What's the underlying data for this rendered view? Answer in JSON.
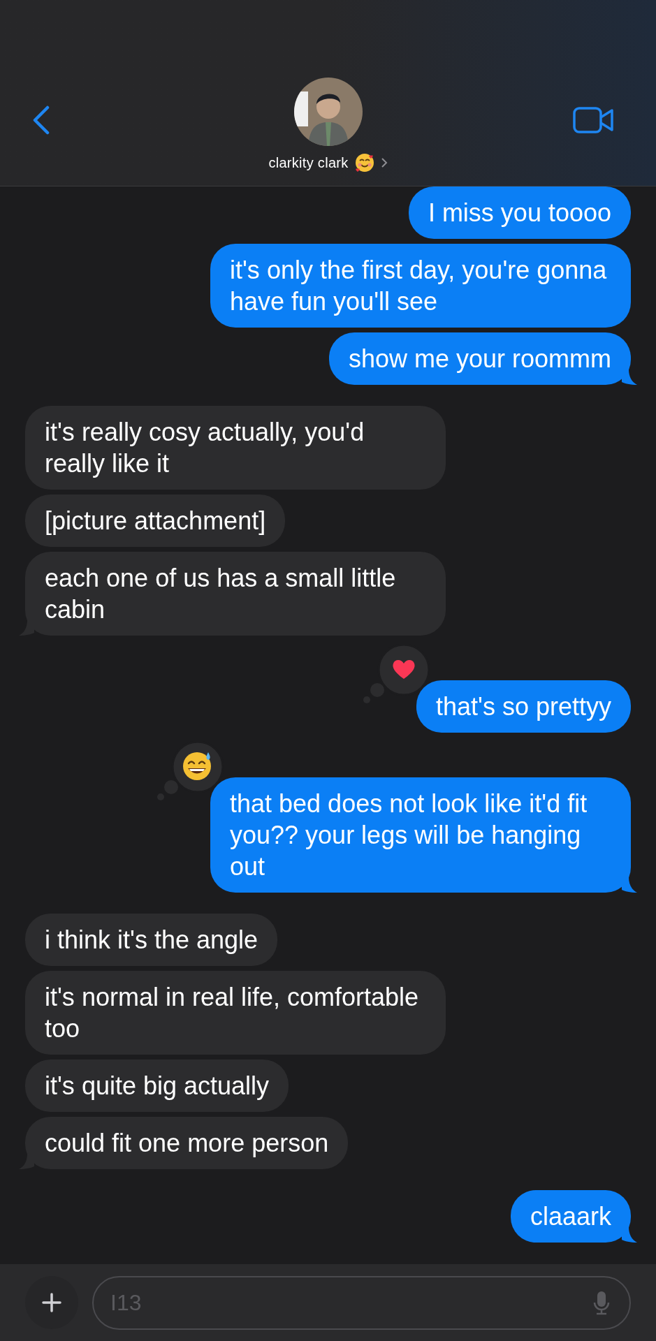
{
  "header": {
    "contact_name": "clarkity clark"
  },
  "messages": [
    {
      "outgoing": true,
      "text": "I miss you toooo",
      "tail": false
    },
    {
      "outgoing": true,
      "text": "it's only the first day, you're gonna have fun you'll see",
      "tail": false
    },
    {
      "outgoing": true,
      "text": "show me your roommm",
      "tail": true
    },
    {
      "outgoing": false,
      "text": "it's really cosy actually, you'd really like it",
      "tail": false
    },
    {
      "outgoing": false,
      "text": "[picture attachment]",
      "tail": false
    },
    {
      "outgoing": false,
      "text": "each one of us has a small little cabin",
      "tail": true
    },
    {
      "outgoing": true,
      "text": "that's so prettyy",
      "tail": false,
      "reaction": {
        "kind": "heart"
      }
    },
    {
      "outgoing": true,
      "text": "that bed does not look like it'd fit you?? your legs will be hanging out",
      "tail": true,
      "reaction": {
        "kind": "sweat-smile"
      }
    },
    {
      "outgoing": false,
      "text": "i think it's the angle",
      "tail": false
    },
    {
      "outgoing": false,
      "text": "it's normal in real life, comfortable too",
      "tail": false
    },
    {
      "outgoing": false,
      "text": "it's quite big actually",
      "tail": false
    },
    {
      "outgoing": false,
      "text": "could fit one more person",
      "tail": true
    },
    {
      "outgoing": true,
      "text": "claaark",
      "tail": true
    }
  ],
  "composer": {
    "placeholder": "I13"
  }
}
